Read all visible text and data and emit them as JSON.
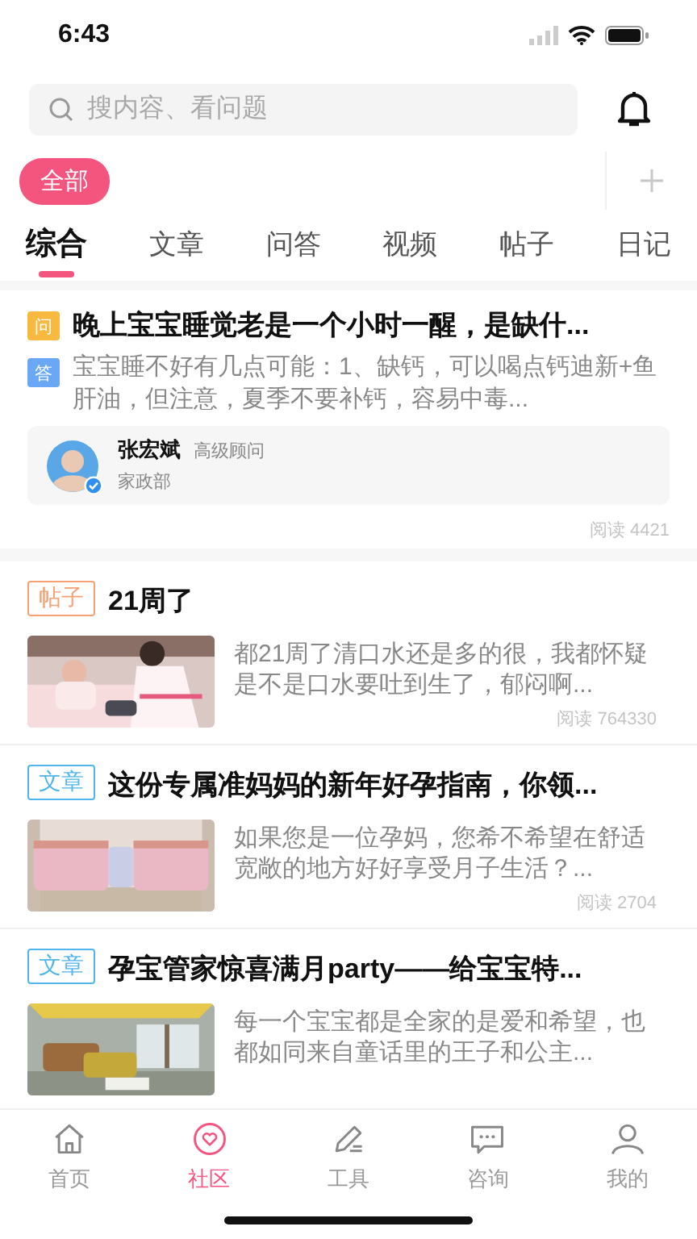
{
  "status_bar": {
    "time": "6:43"
  },
  "search": {
    "placeholder": "搜内容、看问题"
  },
  "chips": [
    {
      "label": "全部",
      "selected": true
    }
  ],
  "tabs": [
    {
      "label": "综合",
      "selected": true
    },
    {
      "label": "文章",
      "selected": false
    },
    {
      "label": "问答",
      "selected": false
    },
    {
      "label": "视频",
      "selected": false
    },
    {
      "label": "帖子",
      "selected": false
    },
    {
      "label": "日记",
      "selected": false
    }
  ],
  "feed": [
    {
      "kind": "qa",
      "question_badge": "问",
      "question": "晚上宝宝睡觉老是一个小时一醒，是缺什...",
      "answer_badge": "答",
      "answer": "宝宝睡不好有几点可能：1、缺钙，可以喝点钙迪新+鱼肝油，但注意，夏季不要补钙，容易中毒...",
      "expert": {
        "name": "张宏斌",
        "title": "高级顾问",
        "department": "家政部",
        "verified": true
      },
      "reads": "阅读 4421"
    },
    {
      "kind": "post",
      "tag": {
        "label": "帖子",
        "kind": "post"
      },
      "title": "21周了",
      "excerpt": "都21周了清口水还是多的很，我都怀疑是不是口水要吐到生了，郁闷啊...",
      "reads": "阅读 764330"
    },
    {
      "kind": "post",
      "tag": {
        "label": "文章",
        "kind": "article"
      },
      "title": "这份专属准妈妈的新年好孕指南，你领...",
      "excerpt": "如果您是一位孕妈，您希不希望在舒适宽敞的地方好好享受月子生活？...",
      "reads": "阅读 2704"
    },
    {
      "kind": "post",
      "tag": {
        "label": "文章",
        "kind": "article"
      },
      "title": "孕宝管家惊喜满月party——给宝宝特...",
      "excerpt": "每一个宝宝都是全家的是爱和希望，也都如同来自童话里的王子和公主..."
    }
  ],
  "bottom_nav": [
    {
      "label": "首页",
      "selected": false
    },
    {
      "label": "社区",
      "selected": true
    },
    {
      "label": "工具",
      "selected": false
    },
    {
      "label": "咨询",
      "selected": false
    },
    {
      "label": "我的",
      "selected": false
    }
  ]
}
